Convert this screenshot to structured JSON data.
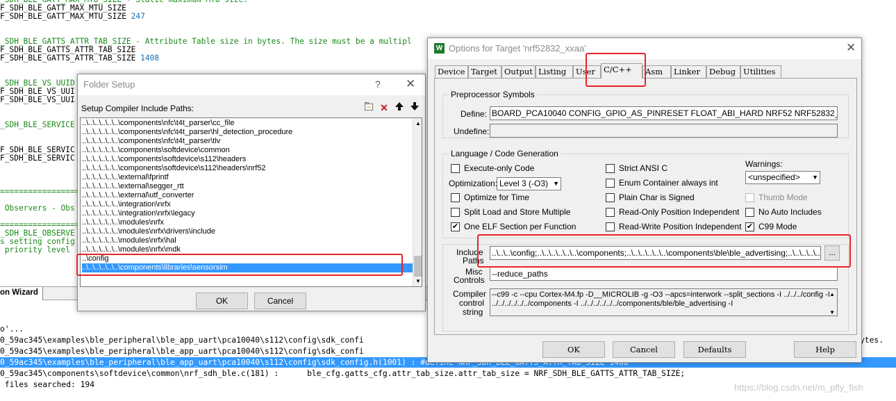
{
  "editor": {
    "lines": [
      {
        "text": "_SDH_BLE_GATT_MAX_MTU_SIZE - Static maximum MTU size.",
        "style": "green"
      },
      {
        "text": "F_SDH_BLE_GATT_MAX_MTU_SIZE",
        "style": "plain"
      },
      {
        "text": "F_SDH_BLE_GATT_MAX_MTU_SIZE ",
        "num": "247",
        "style": "plain"
      },
      {
        "text": "",
        "style": "plain"
      },
      {
        "text": "",
        "style": "plain"
      },
      {
        "text": "_SDH_BLE_GATTS_ATTR_TAB_SIZE - Attribute Table size in bytes. The size must be a multipl",
        "style": "green"
      },
      {
        "text": "F_SDH_BLE_GATTS_ATTR_TAB_SIZE",
        "style": "plain"
      },
      {
        "text": "F_SDH_BLE_GATTS_ATTR_TAB_SIZE ",
        "num": "1408",
        "style": "plain"
      },
      {
        "text": "",
        "style": "plain"
      },
      {
        "text": "",
        "style": "plain"
      },
      {
        "text": "_SDH_BLE_VS_UUID",
        "style": "green"
      },
      {
        "text": "F_SDH_BLE_VS_UUI",
        "style": "plain"
      },
      {
        "text": "F_SDH_BLE_VS_UUI",
        "style": "plain"
      },
      {
        "text": "",
        "style": "plain"
      },
      {
        "text": "",
        "style": "plain"
      },
      {
        "text": "_SDH_BLE_SERVICE",
        "style": "green"
      },
      {
        "text": "",
        "style": "plain"
      },
      {
        "text": "",
        "style": "plain"
      },
      {
        "text": "F_SDH_BLE_SERVIC",
        "style": "plain"
      },
      {
        "text": "F_SDH_BLE_SERVIC",
        "style": "plain"
      },
      {
        "text": "",
        "style": "plain"
      },
      {
        "text": "",
        "style": "plain"
      },
      {
        "text": "",
        "style": "plain"
      },
      {
        "text": "=================",
        "style": "green"
      },
      {
        "text": "",
        "style": "plain"
      },
      {
        "text": " Observers - Obs",
        "style": "green"
      },
      {
        "text": "",
        "style": "plain"
      },
      {
        "text": "=================",
        "style": "green"
      },
      {
        "text": "_SDH_BLE_OBSERVE",
        "style": "green"
      },
      {
        "text": "s setting config",
        "style": "green"
      },
      {
        "text": " priority level",
        "style": "green"
      }
    ],
    "tab_label": "on Wizard"
  },
  "output": {
    "lines": [
      {
        "text": "o'...",
        "selected": false
      },
      {
        "text": "0_59ac345\\examples\\ble_peripheral\\ble_app_uart\\pca10040\\s112\\config\\sdk_confi",
        "selected": false
      },
      {
        "text": "0_59ac345\\examples\\ble_peripheral\\ble_app_uart\\pca10040\\s112\\config\\sdk_confi",
        "selected": false
      },
      {
        "text": "0_59ac345\\examples\\ble_peripheral\\ble_app_uart\\pca10040\\s112\\config\\sdk_config.h(1001) : #define NRF_SDH_BLE_GATTS_ATTR_TAB_SIZE 1408",
        "selected": true
      },
      {
        "text": "0_59ac345\\components\\softdevice\\common\\nrf_sdh_ble.c(181) :      ble_cfg.gatts_cfg.attr_tab_size.attr_tab_size = NRF_SDH_BLE_GATTS_ATTR_TAB_SIZE;",
        "selected": false
      },
      {
        "text": " files searched: 194",
        "selected": false
      }
    ],
    "right_fragment": "ytes.",
    "watermark": "https://blog.csdn.net/m_pfly_fish"
  },
  "folder_setup": {
    "title": "Folder Setup",
    "help_glyph": "?",
    "close_glyph": "✕",
    "label": "Setup Compiler Include Paths:",
    "paths": [
      "..\\..\\..\\..\\..\\..\\components\\nfc\\t4t_parser\\cc_file",
      "..\\..\\..\\..\\..\\..\\components\\nfc\\t4t_parser\\hl_detection_procedure",
      "..\\..\\..\\..\\..\\..\\components\\nfc\\t4t_parser\\tlv",
      "..\\..\\..\\..\\..\\..\\components\\softdevice\\common",
      "..\\..\\..\\..\\..\\..\\components\\softdevice\\s112\\headers",
      "..\\..\\..\\..\\..\\..\\components\\softdevice\\s112\\headers\\nrf52",
      "..\\..\\..\\..\\..\\..\\external\\fprintf",
      "..\\..\\..\\..\\..\\..\\external\\segger_rtt",
      "..\\..\\..\\..\\..\\..\\external\\utf_converter",
      "..\\..\\..\\..\\..\\..\\integration\\nrfx",
      "..\\..\\..\\..\\..\\..\\integration\\nrfx\\legacy",
      "..\\..\\..\\..\\..\\..\\modules\\nrfx",
      "..\\..\\..\\..\\..\\..\\modules\\nrfx\\drivers\\include",
      "..\\..\\..\\..\\..\\..\\modules\\nrfx\\hal",
      "..\\..\\..\\..\\..\\..\\modules\\nrfx\\mdk",
      "..\\config",
      "..\\..\\..\\..\\..\\..\\components\\libraries\\sensorsim"
    ],
    "selected_index": 16,
    "ok_label": "OK",
    "cancel_label": "Cancel"
  },
  "options": {
    "title": "Options for Target 'nrf52832_xxaa'",
    "icon_glyph": "W",
    "close_glyph": "✕",
    "tabs": [
      "Device",
      "Target",
      "Output",
      "Listing",
      "User",
      "C/C++",
      "Asm",
      "Linker",
      "Debug",
      "Utilities"
    ],
    "active_tab": "C/C++",
    "preprocessor": {
      "group_title": "Preprocessor Symbols",
      "define_label": "Define:",
      "define_value": "BOARD_PCA10040 CONFIG_GPIO_AS_PINRESET FLOAT_ABI_HARD NRF52 NRF52832_XXAA NRF",
      "undefine_label": "Undefine:",
      "undefine_value": ""
    },
    "language": {
      "group_title": "Language / Code Generation",
      "execute_only": {
        "label": "Execute-only Code",
        "checked": false
      },
      "optimization_label": "Optimization:",
      "optimization_value": "Level 3 (-O3)",
      "optimize_time": {
        "label": "Optimize for Time",
        "checked": false
      },
      "split_load": {
        "label": "Split Load and Store Multiple",
        "checked": false
      },
      "one_elf": {
        "label": "One ELF Section per Function",
        "checked": true
      },
      "strict_ansi": {
        "label": "Strict ANSI C",
        "checked": false
      },
      "enum_container": {
        "label": "Enum Container always int",
        "checked": false
      },
      "plain_char": {
        "label": "Plain Char is Signed",
        "checked": false
      },
      "ro_pos": {
        "label": "Read-Only Position Independent",
        "checked": false
      },
      "rw_pos": {
        "label": "Read-Write Position Independent",
        "checked": false
      },
      "warnings_label": "Warnings:",
      "warnings_value": "<unspecified>",
      "thumb_mode": {
        "label": "Thumb Mode",
        "checked": false
      },
      "no_auto_includes": {
        "label": "No Auto Includes",
        "checked": false
      },
      "c99_mode": {
        "label": "C99 Mode",
        "checked": true
      }
    },
    "include_label_1": "Include",
    "include_label_2": "Paths",
    "include_value": "..\\..\\..\\config;..\\..\\..\\..\\..\\..\\components;..\\..\\..\\..\\..\\..\\components\\ble\\ble_advertising;..\\..\\..\\..\\..\\..\\",
    "ellipsis_label": "...",
    "misc_label_1": "Misc",
    "misc_label_2": "Controls",
    "misc_value": "--reduce_paths",
    "compiler_label_1": "Compiler",
    "compiler_label_2": "control",
    "compiler_label_3": "string",
    "compiler_line_1": "--c99 -c --cpu Cortex-M4.fp -D__MICROLIB -g -O3 --apcs=interwork --split_sections -I ../../../config -I",
    "compiler_line_2": "../../../../../../components -I ../../../../../../components/ble/ble_advertising -I",
    "ok_label": "OK",
    "cancel_label": "Cancel",
    "defaults_label": "Defaults",
    "help_label": "Help"
  }
}
